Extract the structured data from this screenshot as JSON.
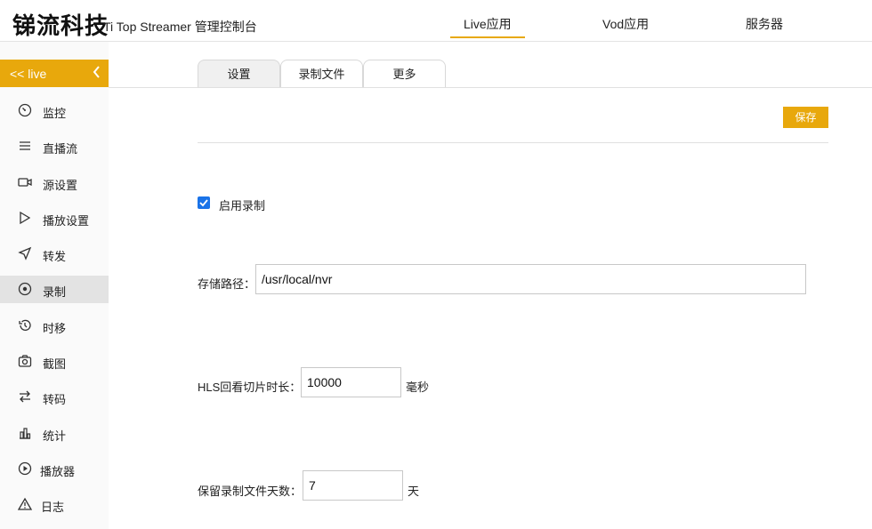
{
  "header": {
    "brand": "锑流科技",
    "subtitle": "Ti Top Streamer 管理控制台",
    "nav": [
      {
        "label": "Live应用",
        "active": true
      },
      {
        "label": "Vod应用",
        "active": false
      },
      {
        "label": "服务器",
        "active": false
      }
    ]
  },
  "sidebar": {
    "header_label": "<<  live",
    "collapse_icon": "chevron-left-icon",
    "items": [
      {
        "label": "监控",
        "icon": "dashboard-icon"
      },
      {
        "label": "直播流",
        "icon": "list-icon"
      },
      {
        "label": "源设置",
        "icon": "video-camera-icon"
      },
      {
        "label": "播放设置",
        "icon": "play-icon"
      },
      {
        "label": "转发",
        "icon": "send-icon"
      },
      {
        "label": "录制",
        "icon": "record-icon",
        "active": true
      },
      {
        "label": "时移",
        "icon": "history-icon"
      },
      {
        "label": "截图",
        "icon": "camera-icon"
      },
      {
        "label": "转码",
        "icon": "transcode-icon"
      },
      {
        "label": "统计",
        "icon": "bar-chart-icon"
      },
      {
        "label": "播放器",
        "icon": "player-icon"
      },
      {
        "label": "日志",
        "icon": "warning-icon"
      }
    ]
  },
  "tabs": [
    {
      "label": "设置",
      "active": true
    },
    {
      "label": "录制文件",
      "active": false
    },
    {
      "label": "更多",
      "active": false
    }
  ],
  "toolbar": {
    "save_label": "保存"
  },
  "form": {
    "enable_record": {
      "label": "启用录制",
      "checked": true
    },
    "storage_path": {
      "label": "存储路径：",
      "value": "/usr/local/nvr"
    },
    "hls_segment": {
      "label": "HLS回看切片时长：",
      "value": "10000",
      "unit": "毫秒"
    },
    "keep_days": {
      "label": "保留录制文件天数：",
      "value": "7",
      "unit": "天"
    }
  },
  "colors": {
    "accent": "#e8a80c",
    "checkbox": "#1a73e8"
  }
}
